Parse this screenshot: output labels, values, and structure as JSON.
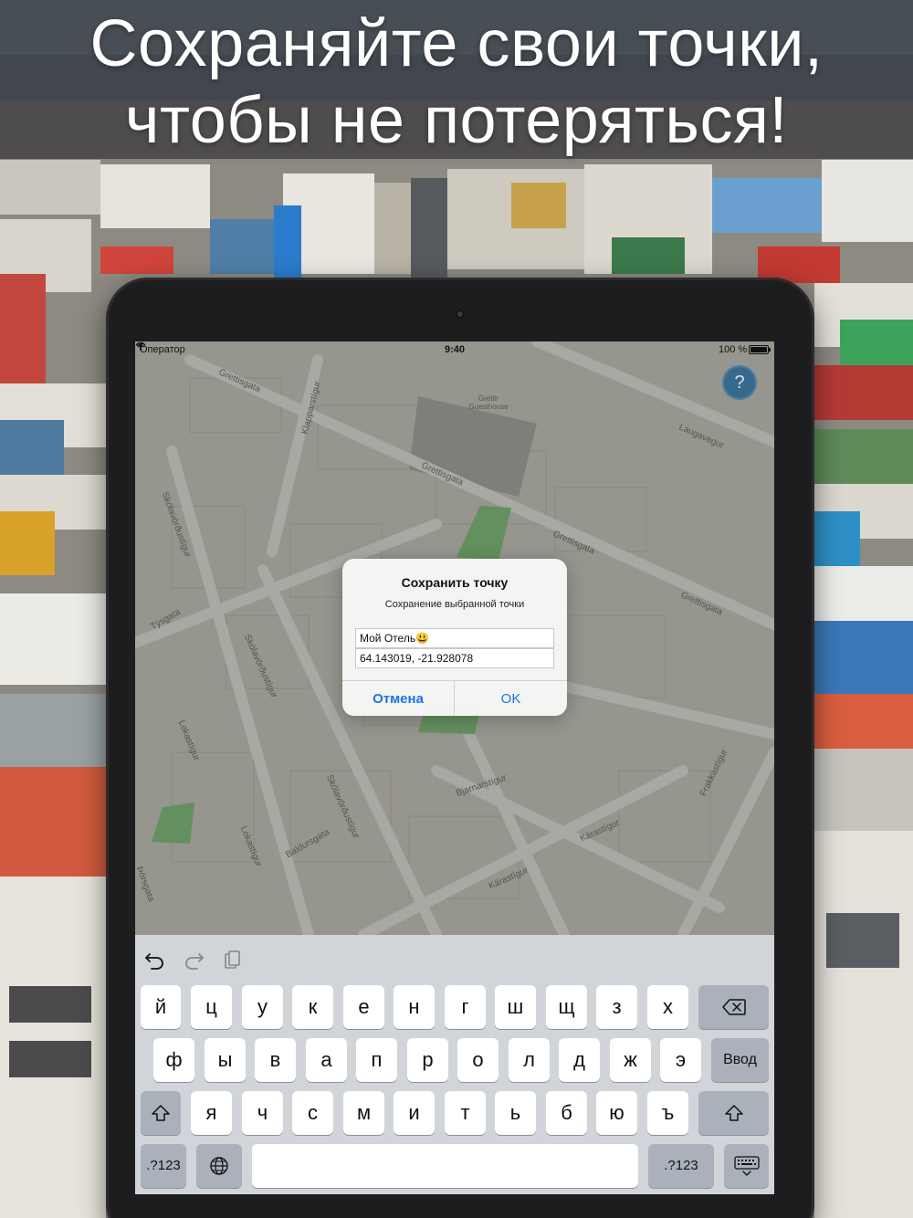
{
  "headline": {
    "line1": "Сохраняйте свои точки,",
    "line2": "чтобы не потеряться!"
  },
  "status_bar": {
    "carrier": "Оператор",
    "time": "9:40",
    "battery": "100 %"
  },
  "map": {
    "help_label": "?",
    "streets": [
      "Grettisgata",
      "Grettisgata",
      "Grettisgata",
      "Grettisgata",
      "Laugavegur",
      "Klapparstígur",
      "Skólavörðustígur",
      "Skólavörðustígur",
      "Skólavörðustígur",
      "Týsgata",
      "Lokastígur",
      "Lokastígur",
      "Baldursgata",
      "Bjarnarstígur",
      "Kárastígur",
      "Kárastígur",
      "Frakkastígur",
      "Þórsgata",
      "Grettir Guesthouse"
    ]
  },
  "alert": {
    "title": "Сохранить точку",
    "message": "Сохранение выбранной точки",
    "name_value": "Мой Отель😃",
    "coords_value": "64.143019, -21.928078",
    "cancel_label": "Отмена",
    "ok_label": "OK"
  },
  "keyboard": {
    "row1": [
      "й",
      "ц",
      "у",
      "к",
      "е",
      "н",
      "г",
      "ш",
      "щ",
      "з",
      "х"
    ],
    "row2": [
      "ф",
      "ы",
      "в",
      "а",
      "п",
      "р",
      "о",
      "л",
      "д",
      "ж",
      "э"
    ],
    "row3": [
      "я",
      "ч",
      "с",
      "м",
      "и",
      "т",
      "ь",
      "б",
      "ю",
      "ъ"
    ],
    "return_label": "Ввод",
    "numbers_label": ".?123",
    "icons": {
      "undo": "undo-icon",
      "redo": "redo-icon",
      "paste": "paste-icon",
      "backspace": "backspace-icon",
      "shift": "shift-icon",
      "globe": "globe-icon",
      "hide_keyboard": "keyboard-dismiss-icon"
    }
  }
}
